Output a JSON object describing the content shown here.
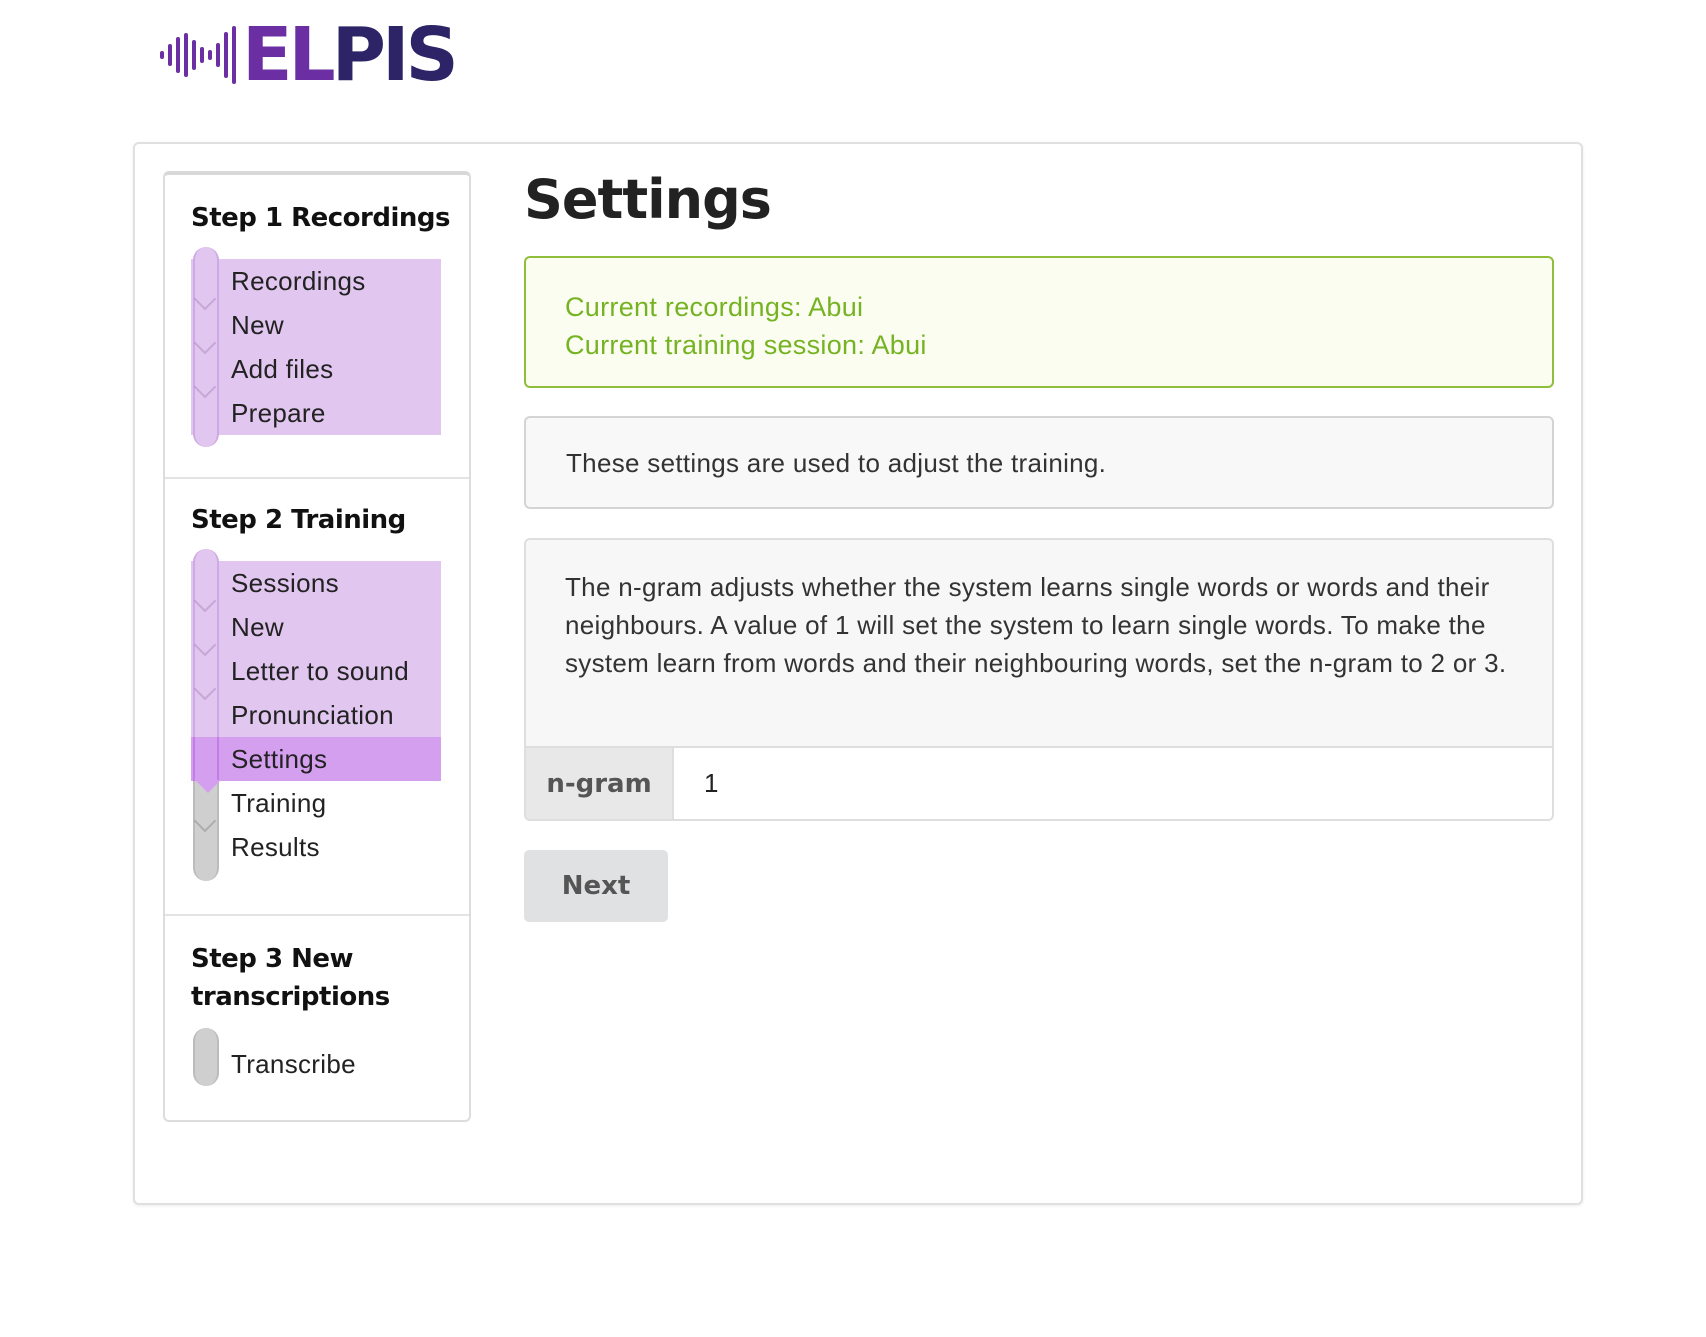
{
  "logo": {
    "text_a": "EL",
    "text_b": "PIS",
    "bar_color": "#6b2fa3",
    "text_color_a": "#6b2fa3",
    "text_color_b": "#2c2466"
  },
  "sidebar": {
    "steps": [
      {
        "title": "Step 1 Recordings",
        "items": [
          {
            "label": "Recordings",
            "state": "done"
          },
          {
            "label": "New",
            "state": "done"
          },
          {
            "label": "Add files",
            "state": "done"
          },
          {
            "label": "Prepare",
            "state": "done"
          }
        ]
      },
      {
        "title": "Step 2 Training",
        "items": [
          {
            "label": "Sessions",
            "state": "done"
          },
          {
            "label": "New",
            "state": "done"
          },
          {
            "label": "Letter to sound",
            "state": "done"
          },
          {
            "label": "Pronunciation",
            "state": "done"
          },
          {
            "label": "Settings",
            "state": "active"
          },
          {
            "label": "Training",
            "state": "todo"
          },
          {
            "label": "Results",
            "state": "todo"
          }
        ]
      },
      {
        "title_line1": "Step 3 New",
        "title_line2": "transcriptions",
        "items": [
          {
            "label": "Transcribe",
            "state": "todo"
          }
        ]
      }
    ]
  },
  "main": {
    "title": "Settings",
    "status": {
      "recordings": "Current recordings: Abui",
      "session": "Current training session: Abui"
    },
    "info": "These settings are used to adjust the training.",
    "description": "The n-gram adjusts whether the system learns single words or words and their neighbours. A value of 1 will set the system to learn single words. To make the system learn from words and their neighbouring words, set the n-gram to 2 or 3.",
    "ngram": {
      "label": "n-gram",
      "value": "1"
    },
    "next_label": "Next"
  },
  "colors": {
    "done": "#e1c6ef",
    "active": "#d59ff0",
    "todo": "#cfcfcf",
    "status_border": "#8fbf3a",
    "status_text": "#76b323"
  }
}
